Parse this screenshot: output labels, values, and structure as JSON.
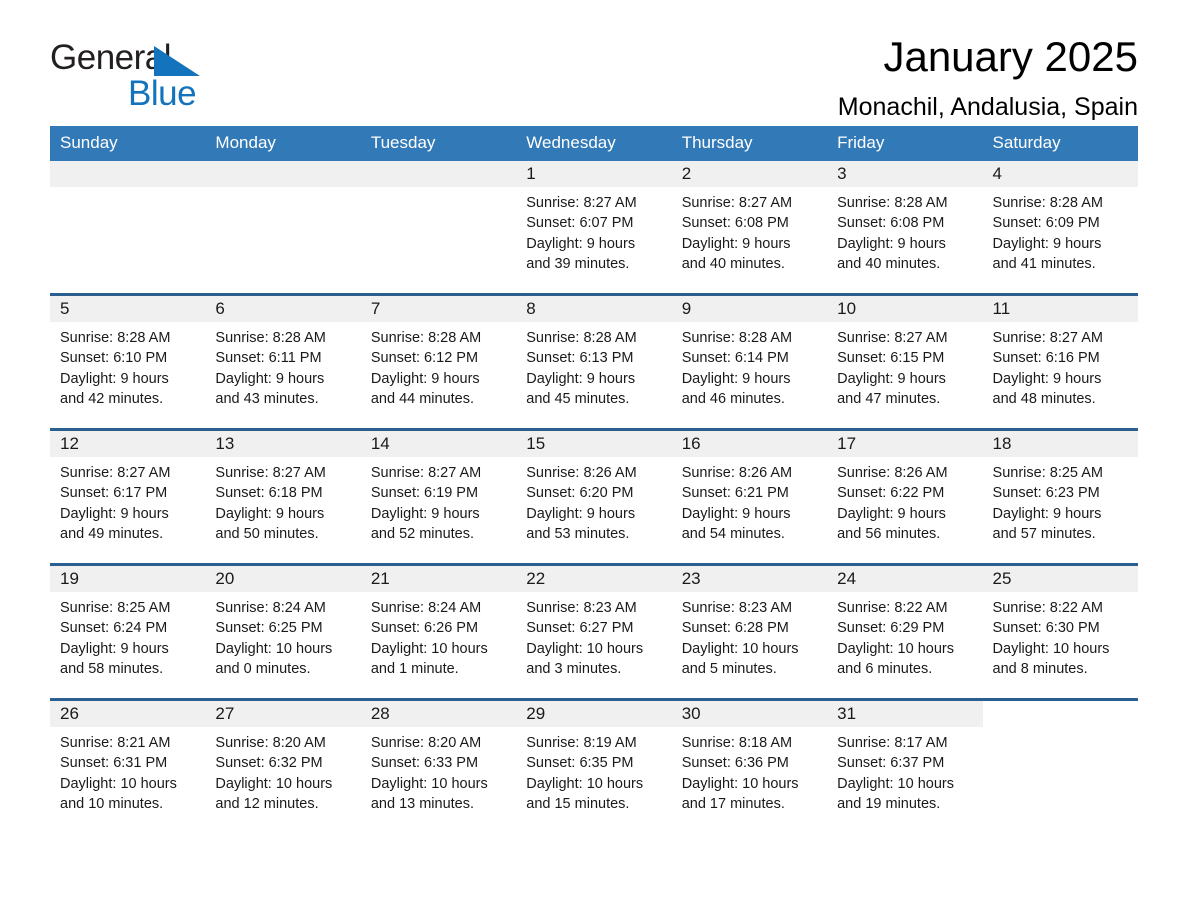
{
  "logo": {
    "text_top": "General",
    "text_bottom": "Blue",
    "triangle_color": "#1473bd",
    "text_top_color": "#231f20"
  },
  "header": {
    "title": "January 2025",
    "subtitle": "Monachil, Andalusia, Spain"
  },
  "colors": {
    "header_band": "#3179b7",
    "week_divider": "#2a5f8f",
    "daynum_band": "#f0f0f0",
    "page_background": "#ffffff"
  },
  "calendar": {
    "weekday_headers": [
      "Sunday",
      "Monday",
      "Tuesday",
      "Wednesday",
      "Thursday",
      "Friday",
      "Saturday"
    ],
    "weeks": [
      [
        {
          "day": "",
          "sunrise": "",
          "sunset": "",
          "daylight1": "",
          "daylight2": "",
          "empty": true
        },
        {
          "day": "",
          "sunrise": "",
          "sunset": "",
          "daylight1": "",
          "daylight2": "",
          "empty": true
        },
        {
          "day": "",
          "sunrise": "",
          "sunset": "",
          "daylight1": "",
          "daylight2": "",
          "empty": true
        },
        {
          "day": "1",
          "sunrise": "Sunrise: 8:27 AM",
          "sunset": "Sunset: 6:07 PM",
          "daylight1": "Daylight: 9 hours",
          "daylight2": "and 39 minutes."
        },
        {
          "day": "2",
          "sunrise": "Sunrise: 8:27 AM",
          "sunset": "Sunset: 6:08 PM",
          "daylight1": "Daylight: 9 hours",
          "daylight2": "and 40 minutes."
        },
        {
          "day": "3",
          "sunrise": "Sunrise: 8:28 AM",
          "sunset": "Sunset: 6:08 PM",
          "daylight1": "Daylight: 9 hours",
          "daylight2": "and 40 minutes."
        },
        {
          "day": "4",
          "sunrise": "Sunrise: 8:28 AM",
          "sunset": "Sunset: 6:09 PM",
          "daylight1": "Daylight: 9 hours",
          "daylight2": "and 41 minutes."
        }
      ],
      [
        {
          "day": "5",
          "sunrise": "Sunrise: 8:28 AM",
          "sunset": "Sunset: 6:10 PM",
          "daylight1": "Daylight: 9 hours",
          "daylight2": "and 42 minutes."
        },
        {
          "day": "6",
          "sunrise": "Sunrise: 8:28 AM",
          "sunset": "Sunset: 6:11 PM",
          "daylight1": "Daylight: 9 hours",
          "daylight2": "and 43 minutes."
        },
        {
          "day": "7",
          "sunrise": "Sunrise: 8:28 AM",
          "sunset": "Sunset: 6:12 PM",
          "daylight1": "Daylight: 9 hours",
          "daylight2": "and 44 minutes."
        },
        {
          "day": "8",
          "sunrise": "Sunrise: 8:28 AM",
          "sunset": "Sunset: 6:13 PM",
          "daylight1": "Daylight: 9 hours",
          "daylight2": "and 45 minutes."
        },
        {
          "day": "9",
          "sunrise": "Sunrise: 8:28 AM",
          "sunset": "Sunset: 6:14 PM",
          "daylight1": "Daylight: 9 hours",
          "daylight2": "and 46 minutes."
        },
        {
          "day": "10",
          "sunrise": "Sunrise: 8:27 AM",
          "sunset": "Sunset: 6:15 PM",
          "daylight1": "Daylight: 9 hours",
          "daylight2": "and 47 minutes."
        },
        {
          "day": "11",
          "sunrise": "Sunrise: 8:27 AM",
          "sunset": "Sunset: 6:16 PM",
          "daylight1": "Daylight: 9 hours",
          "daylight2": "and 48 minutes."
        }
      ],
      [
        {
          "day": "12",
          "sunrise": "Sunrise: 8:27 AM",
          "sunset": "Sunset: 6:17 PM",
          "daylight1": "Daylight: 9 hours",
          "daylight2": "and 49 minutes."
        },
        {
          "day": "13",
          "sunrise": "Sunrise: 8:27 AM",
          "sunset": "Sunset: 6:18 PM",
          "daylight1": "Daylight: 9 hours",
          "daylight2": "and 50 minutes."
        },
        {
          "day": "14",
          "sunrise": "Sunrise: 8:27 AM",
          "sunset": "Sunset: 6:19 PM",
          "daylight1": "Daylight: 9 hours",
          "daylight2": "and 52 minutes."
        },
        {
          "day": "15",
          "sunrise": "Sunrise: 8:26 AM",
          "sunset": "Sunset: 6:20 PM",
          "daylight1": "Daylight: 9 hours",
          "daylight2": "and 53 minutes."
        },
        {
          "day": "16",
          "sunrise": "Sunrise: 8:26 AM",
          "sunset": "Sunset: 6:21 PM",
          "daylight1": "Daylight: 9 hours",
          "daylight2": "and 54 minutes."
        },
        {
          "day": "17",
          "sunrise": "Sunrise: 8:26 AM",
          "sunset": "Sunset: 6:22 PM",
          "daylight1": "Daylight: 9 hours",
          "daylight2": "and 56 minutes."
        },
        {
          "day": "18",
          "sunrise": "Sunrise: 8:25 AM",
          "sunset": "Sunset: 6:23 PM",
          "daylight1": "Daylight: 9 hours",
          "daylight2": "and 57 minutes."
        }
      ],
      [
        {
          "day": "19",
          "sunrise": "Sunrise: 8:25 AM",
          "sunset": "Sunset: 6:24 PM",
          "daylight1": "Daylight: 9 hours",
          "daylight2": "and 58 minutes."
        },
        {
          "day": "20",
          "sunrise": "Sunrise: 8:24 AM",
          "sunset": "Sunset: 6:25 PM",
          "daylight1": "Daylight: 10 hours",
          "daylight2": "and 0 minutes."
        },
        {
          "day": "21",
          "sunrise": "Sunrise: 8:24 AM",
          "sunset": "Sunset: 6:26 PM",
          "daylight1": "Daylight: 10 hours",
          "daylight2": "and 1 minute."
        },
        {
          "day": "22",
          "sunrise": "Sunrise: 8:23 AM",
          "sunset": "Sunset: 6:27 PM",
          "daylight1": "Daylight: 10 hours",
          "daylight2": "and 3 minutes."
        },
        {
          "day": "23",
          "sunrise": "Sunrise: 8:23 AM",
          "sunset": "Sunset: 6:28 PM",
          "daylight1": "Daylight: 10 hours",
          "daylight2": "and 5 minutes."
        },
        {
          "day": "24",
          "sunrise": "Sunrise: 8:22 AM",
          "sunset": "Sunset: 6:29 PM",
          "daylight1": "Daylight: 10 hours",
          "daylight2": "and 6 minutes."
        },
        {
          "day": "25",
          "sunrise": "Sunrise: 8:22 AM",
          "sunset": "Sunset: 6:30 PM",
          "daylight1": "Daylight: 10 hours",
          "daylight2": "and 8 minutes."
        }
      ],
      [
        {
          "day": "26",
          "sunrise": "Sunrise: 8:21 AM",
          "sunset": "Sunset: 6:31 PM",
          "daylight1": "Daylight: 10 hours",
          "daylight2": "and 10 minutes."
        },
        {
          "day": "27",
          "sunrise": "Sunrise: 8:20 AM",
          "sunset": "Sunset: 6:32 PM",
          "daylight1": "Daylight: 10 hours",
          "daylight2": "and 12 minutes."
        },
        {
          "day": "28",
          "sunrise": "Sunrise: 8:20 AM",
          "sunset": "Sunset: 6:33 PM",
          "daylight1": "Daylight: 10 hours",
          "daylight2": "and 13 minutes."
        },
        {
          "day": "29",
          "sunrise": "Sunrise: 8:19 AM",
          "sunset": "Sunset: 6:35 PM",
          "daylight1": "Daylight: 10 hours",
          "daylight2": "and 15 minutes."
        },
        {
          "day": "30",
          "sunrise": "Sunrise: 8:18 AM",
          "sunset": "Sunset: 6:36 PM",
          "daylight1": "Daylight: 10 hours",
          "daylight2": "and 17 minutes."
        },
        {
          "day": "31",
          "sunrise": "Sunrise: 8:17 AM",
          "sunset": "Sunset: 6:37 PM",
          "daylight1": "Daylight: 10 hours",
          "daylight2": "and 19 minutes."
        },
        {
          "day": "",
          "sunrise": "",
          "sunset": "",
          "daylight1": "",
          "daylight2": "",
          "blank": true
        }
      ]
    ]
  }
}
